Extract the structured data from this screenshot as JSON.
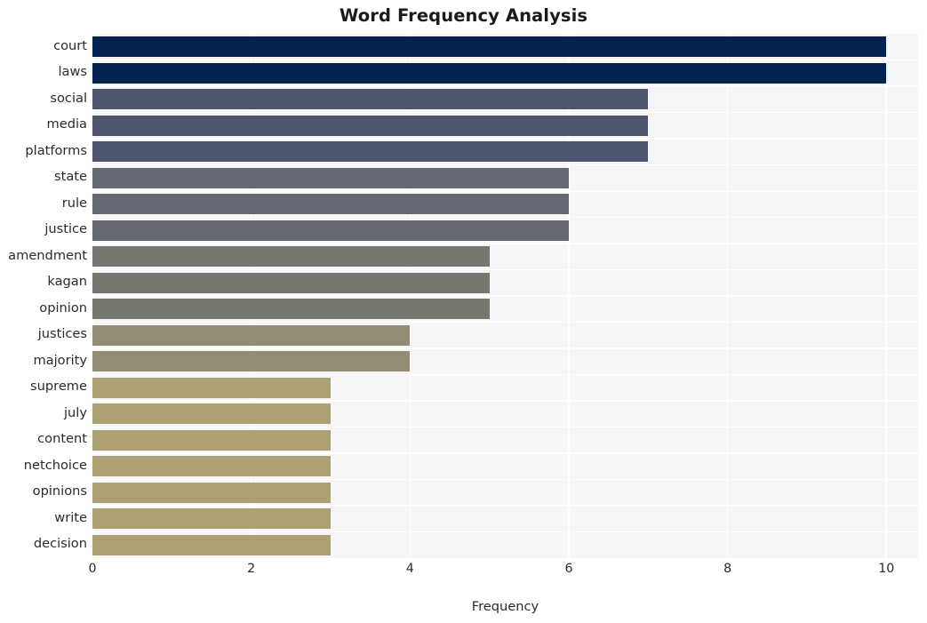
{
  "chart_data": {
    "type": "bar",
    "orientation": "horizontal",
    "title": "Word Frequency Analysis",
    "xlabel": "Frequency",
    "ylabel": "",
    "xlim": [
      0,
      10.4
    ],
    "xticks": [
      "0",
      "2",
      "4",
      "6",
      "8",
      "10"
    ],
    "xtick_values": [
      0,
      2,
      4,
      6,
      8,
      10
    ],
    "grid": true,
    "legend": null,
    "categories": [
      "court",
      "laws",
      "social",
      "media",
      "platforms",
      "state",
      "rule",
      "justice",
      "amendment",
      "kagan",
      "opinion",
      "justices",
      "majority",
      "supreme",
      "july",
      "content",
      "netchoice",
      "opinions",
      "write",
      "decision"
    ],
    "values": [
      10,
      10,
      7,
      7,
      7,
      6,
      6,
      6,
      5,
      5,
      5,
      4,
      4,
      3,
      3,
      3,
      3,
      3,
      3,
      3
    ],
    "bar_colors": [
      "#022350",
      "#022350",
      "#4e566e",
      "#4e566e",
      "#4e566e",
      "#656974",
      "#656974",
      "#656974",
      "#77766f",
      "#77766f",
      "#77766f",
      "#938c77",
      "#938c77",
      "#ada173",
      "#ada173",
      "#ada173",
      "#ada173",
      "#ada173",
      "#ada173",
      "#ada173"
    ]
  },
  "style": {
    "plot_background": "#f6f6f7",
    "figure_background": "#ffffff",
    "gridline_color": "#ffffff",
    "text_color": "#2b2b2b",
    "title_color": "#1b1b1b"
  }
}
